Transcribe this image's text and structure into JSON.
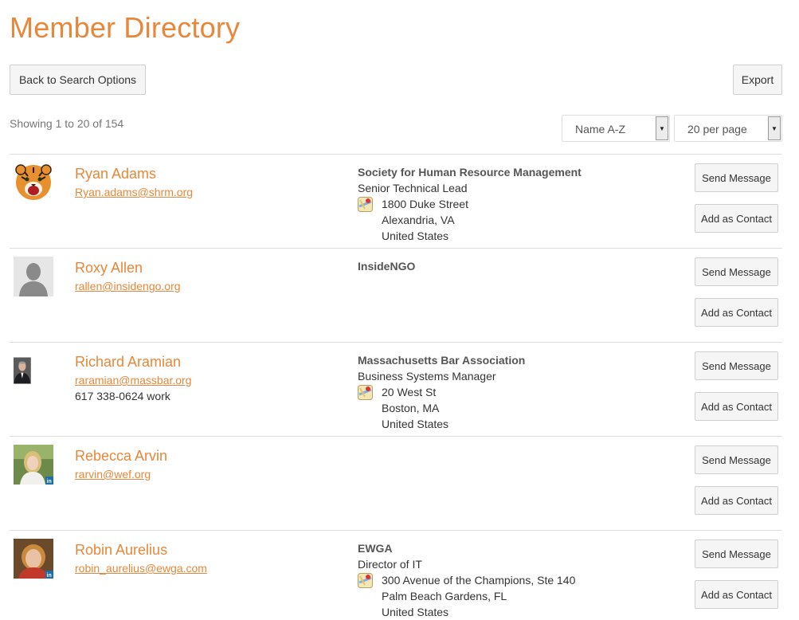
{
  "page": {
    "title": "Member Directory",
    "back_label": "Back to Search Options",
    "export_label": "Export",
    "showing": "Showing 1 to 20 of 154",
    "sort_value": "Name A-Z",
    "per_page_value": "20 per page"
  },
  "actions": {
    "send_message": "Send Message",
    "add_contact": "Add as Contact"
  },
  "members": [
    {
      "name": "Ryan Adams",
      "email": "Ryan.adams@shrm.org",
      "phone": "",
      "org": "Society for Human Resource Management",
      "role": "Senior Technical Lead",
      "street": "1800 Duke Street",
      "city": "Alexandria, VA",
      "country": "United States",
      "avatar": "tiger-avatar"
    },
    {
      "name": "Roxy Allen",
      "email": "rallen@insidengo.org",
      "phone": "",
      "org": "InsideNGO",
      "role": "",
      "street": "",
      "city": "",
      "country": "",
      "avatar": "default-silhouette-avatar"
    },
    {
      "name": "Richard Aramian",
      "email": "raramian@massbar.org",
      "phone": "617 338-0624 work",
      "org": "Massachusetts Bar Association",
      "role": "Business Systems Manager",
      "street": "20 West St",
      "city": "Boston, MA",
      "country": "United States",
      "avatar": "man-suit-photo"
    },
    {
      "name": "Rebecca Arvin",
      "email": "rarvin@wef.org",
      "phone": "",
      "org": "",
      "role": "",
      "street": "",
      "city": "",
      "country": "",
      "avatar": "woman-outdoor-photo"
    },
    {
      "name": "Robin Aurelius",
      "email": "robin_aurelius@ewga.com",
      "phone": "",
      "org": "EWGA",
      "role": "Director of IT",
      "street": "300 Avenue of the Champions, Ste 140",
      "city": "Palm Beach Gardens, FL",
      "country": "United States",
      "avatar": "woman-portrait-photo"
    }
  ],
  "colors": {
    "accent": "#e8873a",
    "text": "#333333",
    "muted": "#777777"
  }
}
